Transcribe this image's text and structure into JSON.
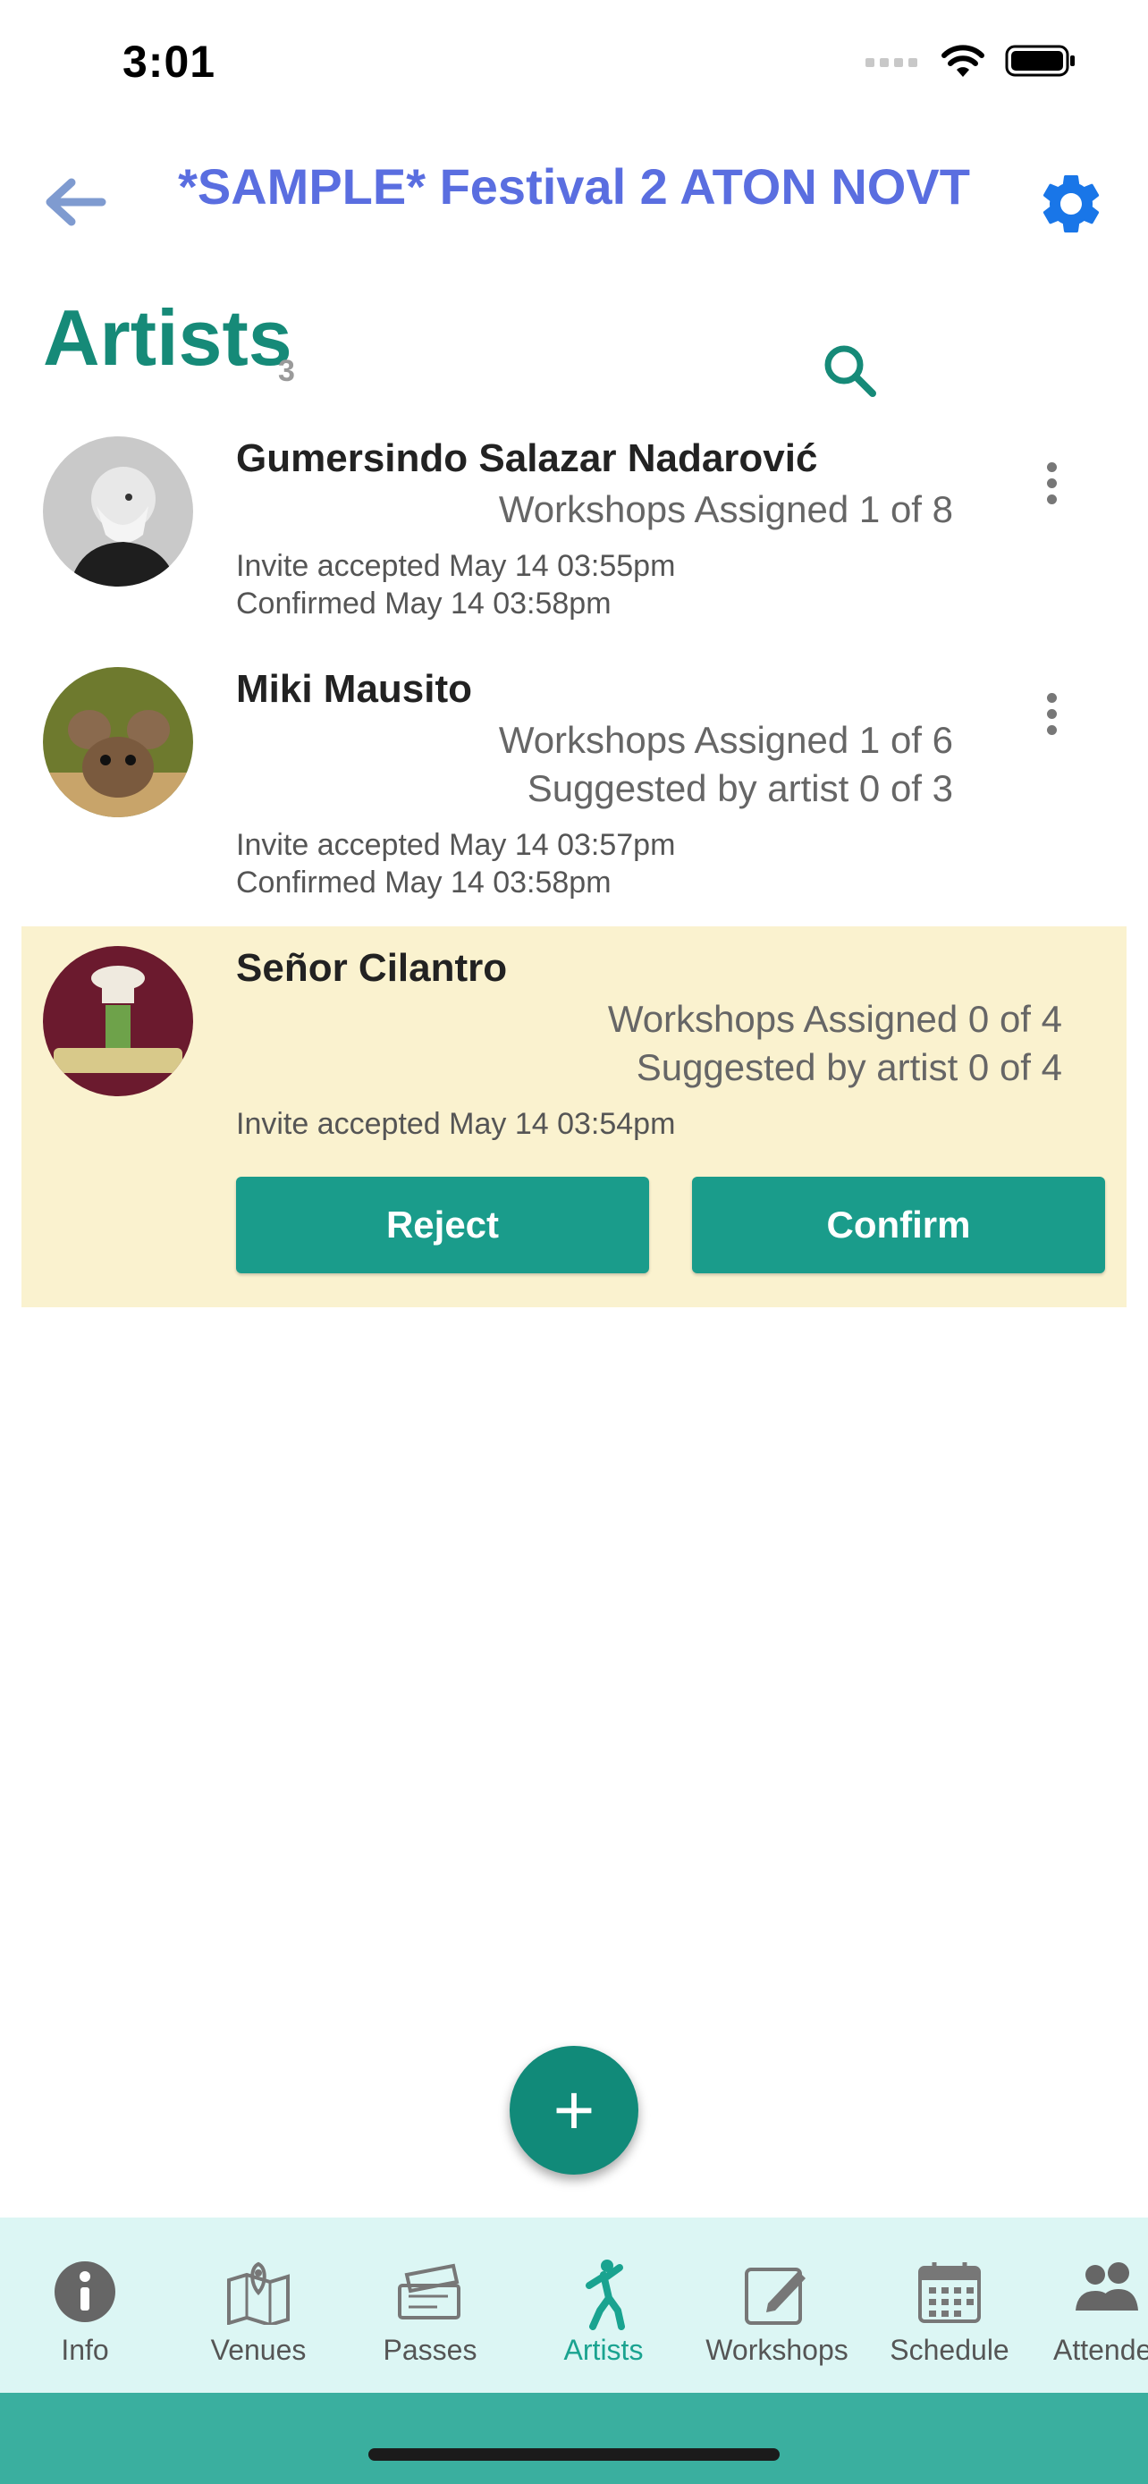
{
  "status_bar": {
    "time": "3:01"
  },
  "header": {
    "title": "*SAMPLE* Festival 2 ATON NOVT"
  },
  "section": {
    "title": "Artists",
    "count": "3"
  },
  "artists": [
    {
      "name": "Gumersindo Salazar Nadarović",
      "workshops_assigned": "Workshops Assigned  1 of 8",
      "invite": "Invite accepted May 14 03:55pm",
      "confirmed": "Confirmed May 14 03:58pm"
    },
    {
      "name": "Miki Mausito",
      "workshops_assigned": "Workshops Assigned  1 of 6",
      "suggested": "Suggested by artist 0 of 3",
      "invite": "Invite accepted May 14 03:57pm",
      "confirmed": "Confirmed May 14 03:58pm"
    },
    {
      "name": "Señor Cilantro",
      "workshops_assigned": "Workshops Assigned  0 of 4",
      "suggested": "Suggested by artist 0 of 4",
      "invite": "Invite accepted May 14 03:54pm",
      "reject_label": "Reject",
      "confirm_label": "Confirm"
    }
  ],
  "fab": {
    "label": "+"
  },
  "bottom_nav": [
    {
      "label": "Info",
      "icon": "info-icon"
    },
    {
      "label": "Venues",
      "icon": "map-icon"
    },
    {
      "label": "Passes",
      "icon": "ticket-icon"
    },
    {
      "label": "Artists",
      "icon": "dancer-icon",
      "active": true
    },
    {
      "label": "Workshops",
      "icon": "edit-icon"
    },
    {
      "label": "Schedule",
      "icon": "calendar-icon"
    },
    {
      "label": "Attende",
      "icon": "people-icon"
    }
  ],
  "colors": {
    "accent": "#168a78",
    "title_blue": "#5a6ee0",
    "pending_bg": "#faf2cf",
    "button": "#1a9c8b",
    "nav_bg": "#dcf6f4"
  }
}
